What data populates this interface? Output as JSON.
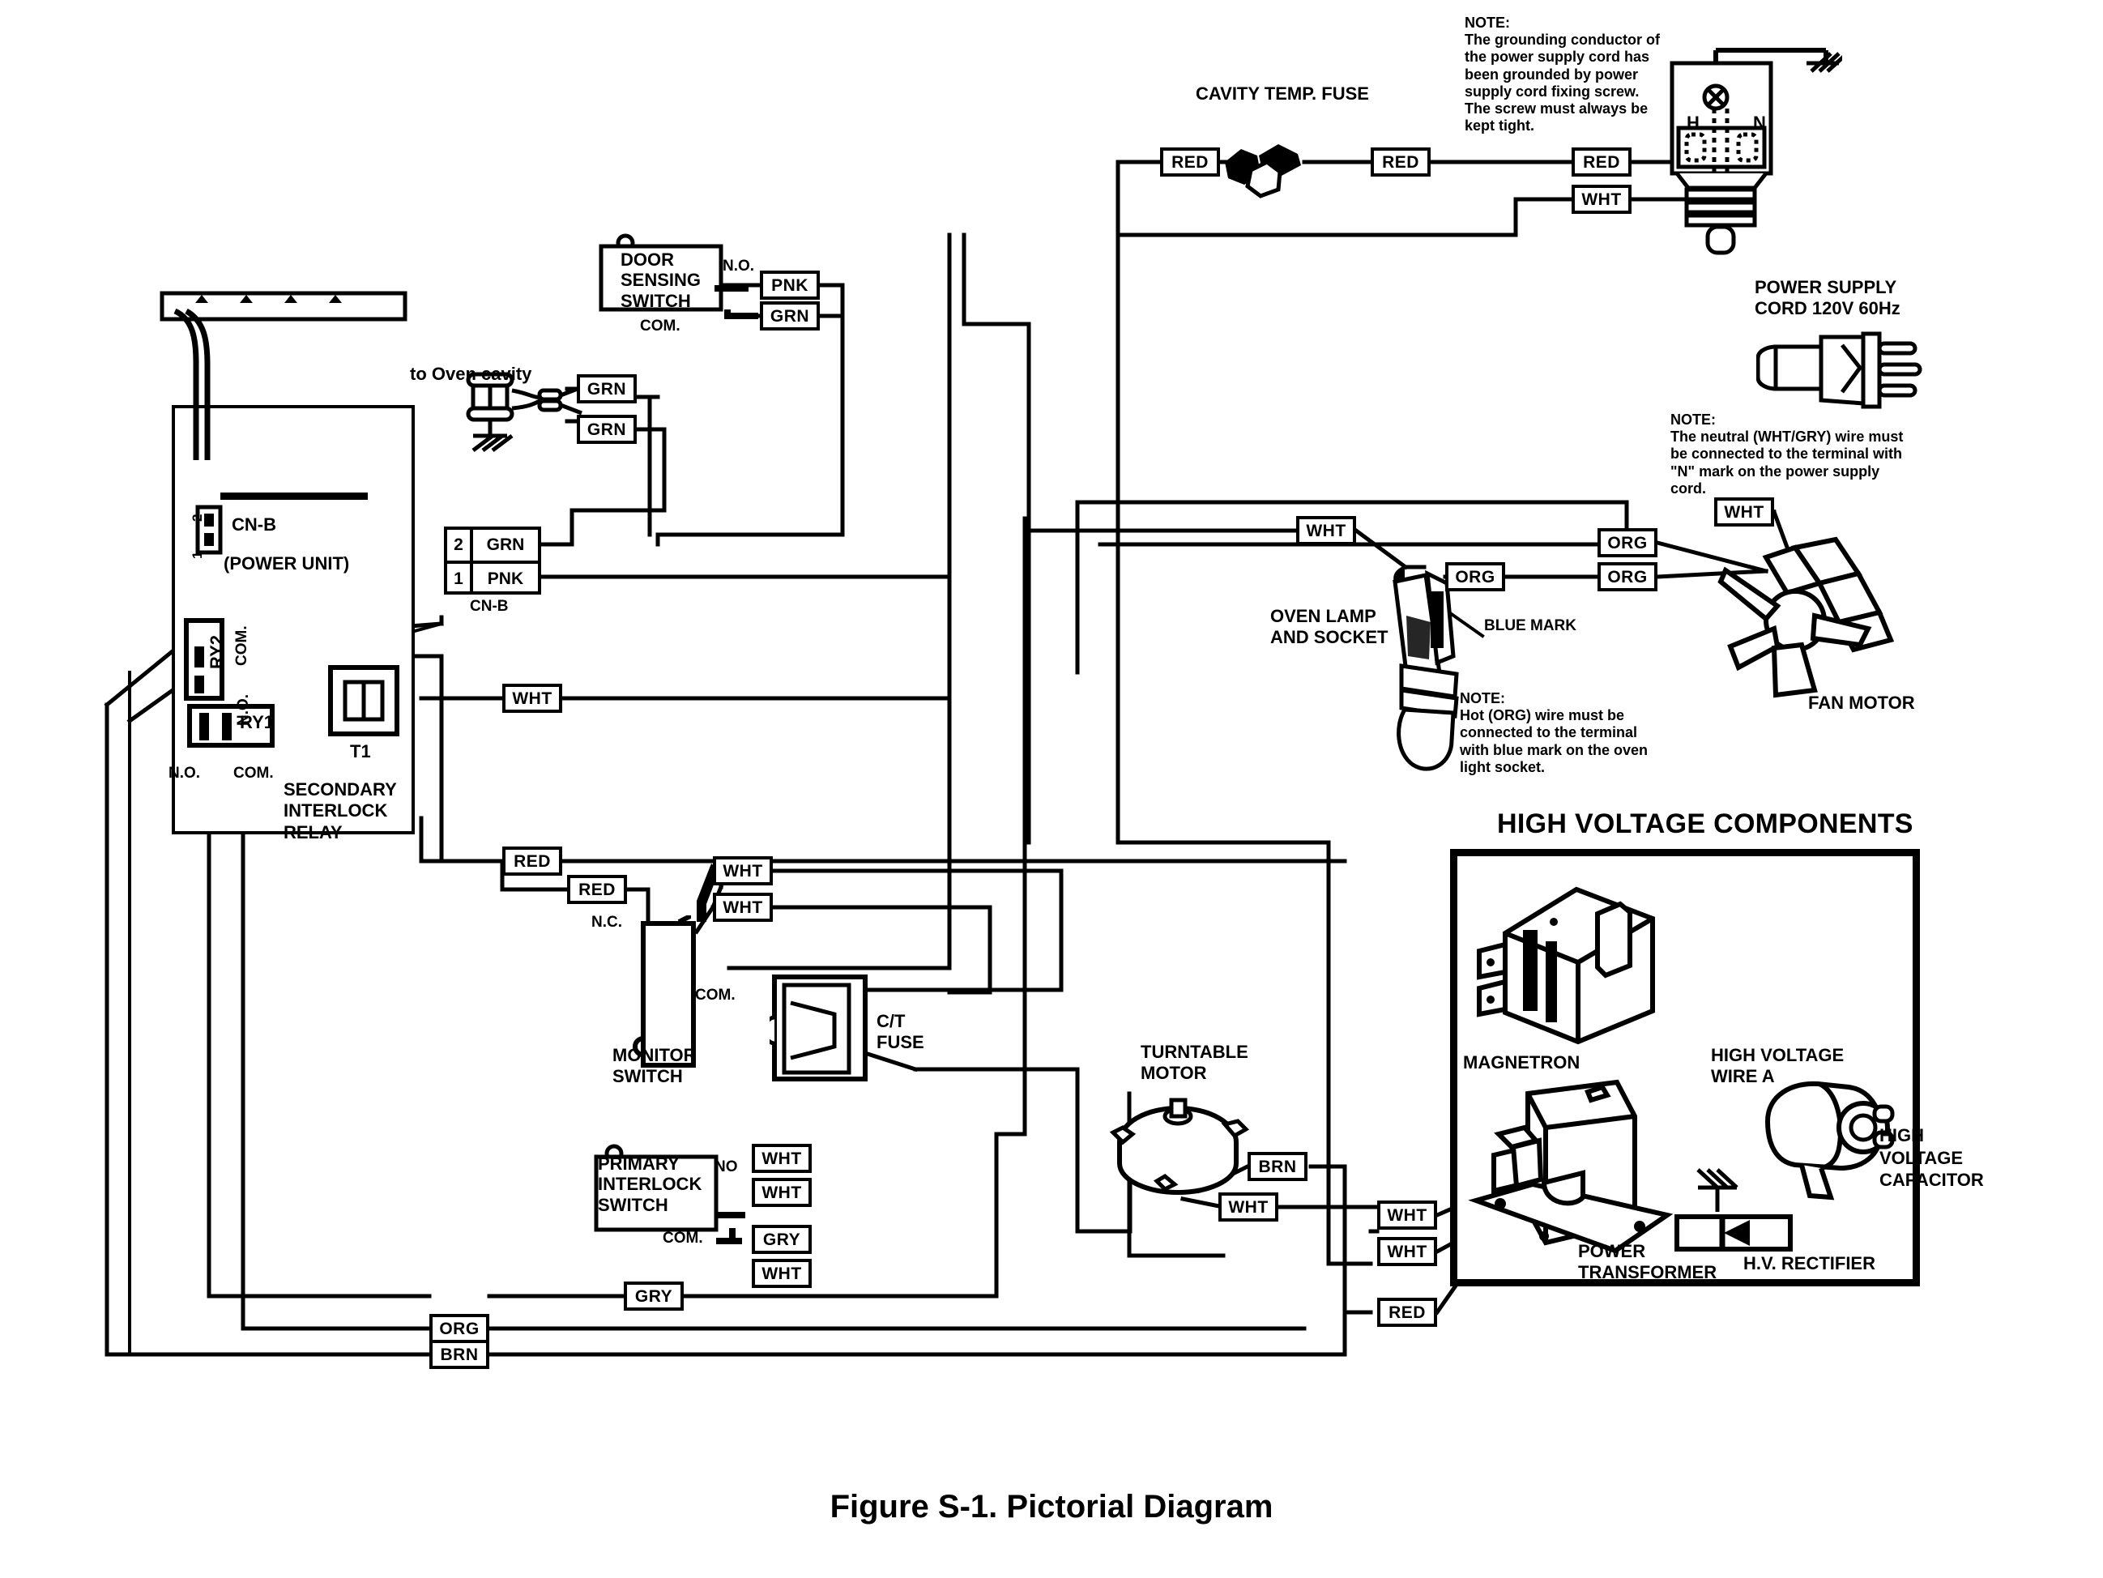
{
  "figure": {
    "caption": "Figure S-1. Pictorial Diagram"
  },
  "sections": {
    "high_voltage": "HIGH VOLTAGE COMPONENTS"
  },
  "notes": {
    "grounding": "NOTE:\nThe grounding conductor of\nthe power supply cord has\nbeen grounded by power\nsupply cord fixing screw.\nThe screw must always  be\nkept tight.",
    "neutral": "NOTE:\nThe neutral (WHT/GRY) wire must\nbe connected to the terminal with\n\"N\" mark on the power supply\ncord.",
    "hot_org": "NOTE:\nHot (ORG) wire must be\nconnected to the terminal\nwith blue mark on the oven\nlight socket."
  },
  "components": {
    "cavity_temp_fuse": "CAVITY TEMP. FUSE",
    "door_sensing_switch": "DOOR\nSENSING\nSWITCH",
    "to_oven_cavity": "to Oven cavity",
    "power_unit": "(POWER UNIT)",
    "cn_b_onboard": "CN-B",
    "cn_b_connector": "CN-B",
    "secondary_interlock_relay": "SECONDARY\nINTERLOCK\nRELAY",
    "ry1": "RY1",
    "ry2": "RY2",
    "t1": "T1",
    "monitor_switch": "MONITOR\nSWITCH",
    "ct_fuse": "C/T\nFUSE",
    "primary_interlock_switch": "PRIMARY\nINTERLOCK\nSWITCH",
    "turntable_motor": "TURNTABLE\nMOTOR",
    "oven_lamp_and_socket": "OVEN LAMP\nAND SOCKET",
    "blue_mark": "BLUE MARK",
    "fan_motor": "FAN MOTOR",
    "power_supply_cord": "POWER SUPPLY\nCORD 120V 60Hz",
    "magnetron": "MAGNETRON",
    "power_transformer": "POWER\nTRANSFORMER",
    "high_voltage_wire_a": "HIGH VOLTAGE\nWIRE A",
    "high_voltage_capacitor": "HIGH\nVOLTAGE\nCAPACITOR",
    "hv_rectifier": "H.V. RECTIFIER"
  },
  "terminals": {
    "h": "H",
    "n": "N",
    "no": "N.O.",
    "no_short": "NO",
    "nc": "N.C.",
    "com": "COM.",
    "com_ry2": "COM.",
    "no_ry2": "N.O.",
    "no_ry1": "N.O.",
    "com_ry1": "COM."
  },
  "connector_cn_b": {
    "label": "CN-B",
    "rows": [
      {
        "pin": "2",
        "wire": "GRN"
      },
      {
        "pin": "1",
        "wire": "PNK"
      }
    ]
  },
  "cn_b_pins": {
    "top": "2",
    "bottom": "1"
  },
  "wire_chips": [
    {
      "id": "w_red_fuse_l",
      "text": "RED"
    },
    {
      "id": "w_red_fuse_r",
      "text": "RED"
    },
    {
      "id": "w_red_plug",
      "text": "RED"
    },
    {
      "id": "w_wht_plug",
      "text": "WHT"
    },
    {
      "id": "w_pnk_door",
      "text": "PNK"
    },
    {
      "id": "w_grn_door",
      "text": "GRN"
    },
    {
      "id": "w_grn_cav_top",
      "text": "GRN"
    },
    {
      "id": "w_grn_cav_bot",
      "text": "GRN"
    },
    {
      "id": "w_wht_mid",
      "text": "WHT"
    },
    {
      "id": "w_red_mid",
      "text": "RED"
    },
    {
      "id": "w_red_mon",
      "text": "RED"
    },
    {
      "id": "w_wht_mon_1",
      "text": "WHT"
    },
    {
      "id": "w_wht_mon_2",
      "text": "WHT"
    },
    {
      "id": "w_wht_lamp",
      "text": "WHT"
    },
    {
      "id": "w_org_lamp",
      "text": "ORG"
    },
    {
      "id": "w_wht_fan",
      "text": "WHT"
    },
    {
      "id": "w_org_fan_1",
      "text": "ORG"
    },
    {
      "id": "w_org_fan_2",
      "text": "ORG"
    },
    {
      "id": "w_wht_pri_1",
      "text": "WHT"
    },
    {
      "id": "w_wht_pri_2",
      "text": "WHT"
    },
    {
      "id": "w_gry_pri",
      "text": "GRY"
    },
    {
      "id": "w_wht_pri_3",
      "text": "WHT"
    },
    {
      "id": "w_brn_tt",
      "text": "BRN"
    },
    {
      "id": "w_wht_tt",
      "text": "WHT"
    },
    {
      "id": "w_wht_pt_1",
      "text": "WHT"
    },
    {
      "id": "w_wht_pt_2",
      "text": "WHT"
    },
    {
      "id": "w_red_pt",
      "text": "RED"
    },
    {
      "id": "w_gry_bus",
      "text": "GRY"
    },
    {
      "id": "w_org_bus",
      "text": "ORG"
    },
    {
      "id": "w_brn_bus",
      "text": "BRN"
    }
  ]
}
